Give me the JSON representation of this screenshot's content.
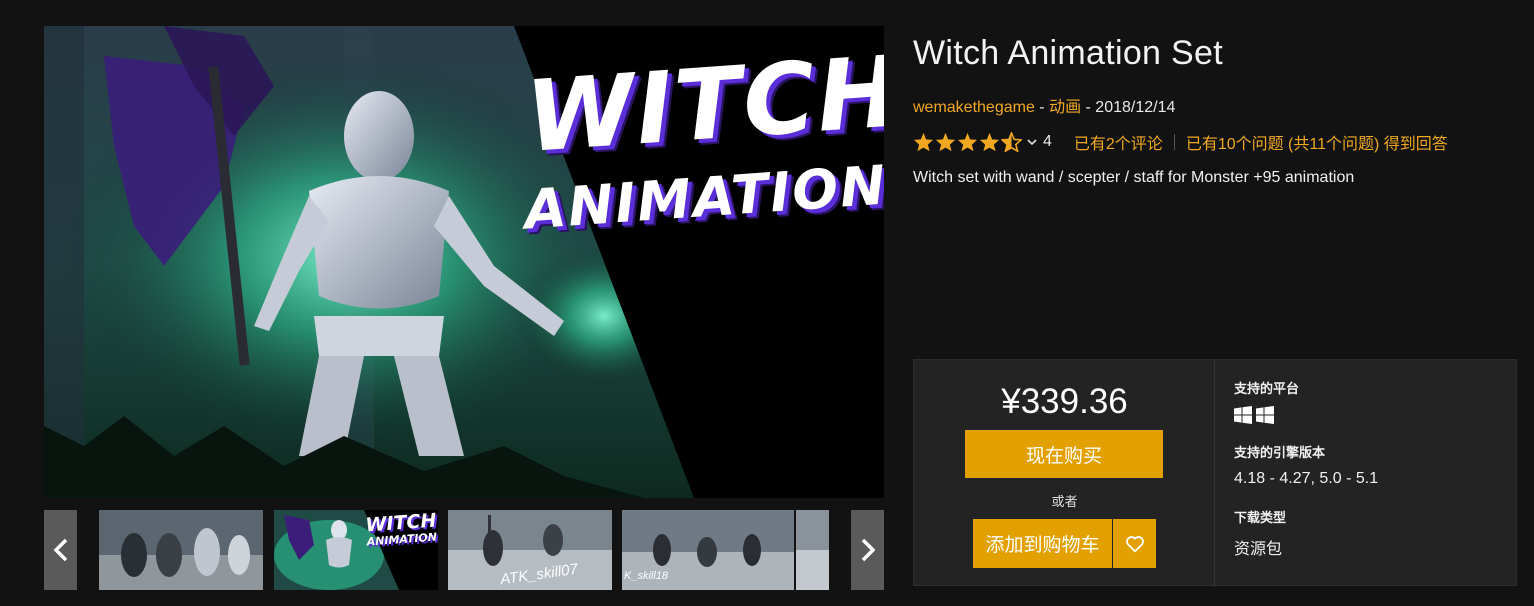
{
  "hero": {
    "title_line1": "WITCH",
    "title_line2": "ANIMATION"
  },
  "thumbnails": {
    "prev_icon": "chevron-left-icon",
    "next_icon": "chevron-right-icon",
    "items": [
      {
        "caption": ""
      },
      {
        "caption_line1": "WITCH",
        "caption_line2": "ANIMATION"
      },
      {
        "caption": "ATK_skill07"
      },
      {
        "caption": "K_skill18"
      },
      {
        "caption": ""
      }
    ]
  },
  "product": {
    "title": "Witch Animation Set",
    "seller": "wemakethegame",
    "separator": " - ",
    "category": "动画",
    "date": "2018/12/14",
    "rating_value": 4.5,
    "rating_count": "4",
    "reviews_text": "已有2个评论",
    "questions_text": "已有10个问题 (共11个问题) 得到回答",
    "description": "Witch set with wand / scepter / staff for Monster +95 animation"
  },
  "purchase": {
    "price": "¥339.36",
    "buy_now": "现在购买",
    "or_text": "或者",
    "add_to_cart": "添加到购物车",
    "wishlist_icon": "heart-icon"
  },
  "specs": {
    "platform_label": "支持的平台",
    "platform_icons": [
      "windows-icon",
      "windows-icon"
    ],
    "engine_label": "支持的引擎版本",
    "engine_value": "4.18 - 4.27, 5.0 - 5.1",
    "download_label": "下载类型",
    "download_value": "资源包"
  },
  "colors": {
    "background": "#121212",
    "accent_orange": "#f0a820",
    "button": "#e2a100",
    "panel": "#232323"
  }
}
